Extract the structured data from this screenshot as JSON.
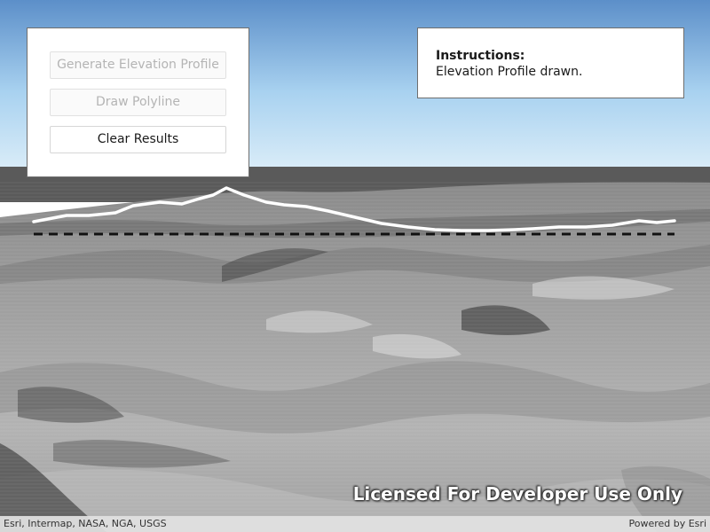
{
  "controls": {
    "generate_label": "Generate Elevation Profile",
    "generate_enabled": false,
    "draw_label": "Draw Polyline",
    "draw_enabled": false,
    "clear_label": "Clear Results",
    "clear_enabled": true
  },
  "instructions": {
    "title": "Instructions:",
    "text": "Elevation Profile drawn."
  },
  "watermark": "Licensed For Developer Use Only",
  "attribution": {
    "sources": "Esri, Intermap, NASA, NGA, USGS",
    "powered_by": "Powered by Esri"
  },
  "colors": {
    "sky_top": "#5c8fc9",
    "sky_bottom": "#d9ecf8",
    "profile_line": "#ffffff",
    "polyline": "#111111"
  }
}
